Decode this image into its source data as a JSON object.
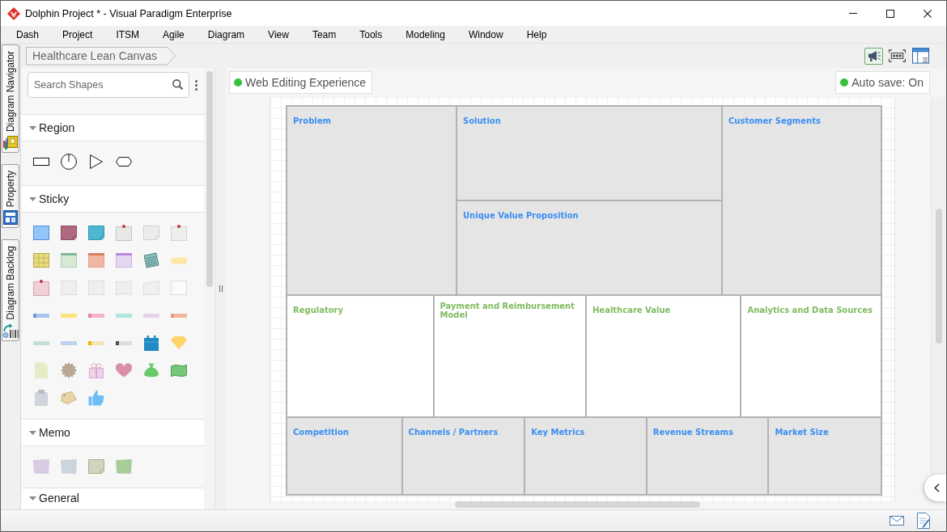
{
  "window": {
    "title": "Dolphin Project * - Visual Paradigm Enterprise"
  },
  "menu": [
    "Dash",
    "Project",
    "ITSM",
    "Agile",
    "Diagram",
    "View",
    "Team",
    "Tools",
    "Modeling",
    "Window",
    "Help"
  ],
  "side_tabs": [
    {
      "label": "Diagram Navigator"
    },
    {
      "label": "Property"
    },
    {
      "label": "Diagram Backlog"
    }
  ],
  "breadcrumb": {
    "label": "Healthcare Lean Canvas"
  },
  "diagram_toolbar": [
    {
      "active": true
    },
    {
      "active": false
    },
    {
      "active": false
    }
  ],
  "shape_panel": {
    "search": {
      "placeholder": "Search Shapes"
    },
    "sections": [
      {
        "title": "Region",
        "expanded": true
      },
      {
        "title": "Sticky",
        "expanded": true
      },
      {
        "title": "Memo",
        "expanded": true
      },
      {
        "title": "General",
        "expanded": true
      }
    ]
  },
  "canvas": {
    "editing_badge": "Web Editing Experience",
    "autosave_badge": "Auto save: On",
    "lean_canvas": {
      "sections": [
        {
          "kind": "shaded",
          "blocks": [
            {
              "title": "Problem",
              "kind": "full"
            },
            {
              "title": "Solution",
              "kind": "half"
            },
            {
              "title": "Unique Value Proposition",
              "kind": "half"
            },
            {
              "title": "Customer Segments",
              "kind": "full"
            }
          ]
        },
        {
          "kind": "plain",
          "blocks": [
            {
              "title": "Regulatory",
              "kind": "full"
            },
            {
              "title": "Payment and Reimbursement Model",
              "kind": "full"
            },
            {
              "title": "Healthcare Value",
              "kind": "full"
            },
            {
              "title": "Analytics and Data Sources",
              "kind": "full"
            }
          ]
        },
        {
          "kind": "shaded",
          "blocks": [
            {
              "title": "Competition",
              "kind": "full"
            },
            {
              "title": "Channels / Partners",
              "kind": "full"
            },
            {
              "title": "Key Metrics",
              "kind": "full"
            },
            {
              "title": "Revenue Streams",
              "kind": "full"
            },
            {
              "title": "Market Size",
              "kind": "full"
            }
          ]
        }
      ]
    }
  }
}
